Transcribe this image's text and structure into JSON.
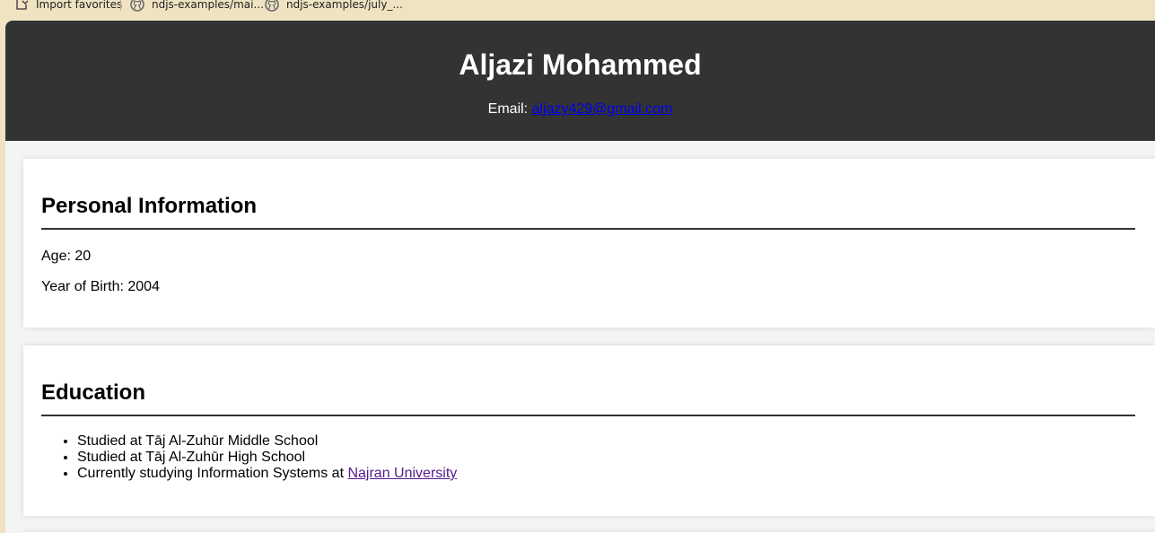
{
  "bookmarks": [
    {
      "label": "Import favorites",
      "icon": "import-icon"
    },
    {
      "label": "ndjs-examples/mai...",
      "icon": "github-icon"
    },
    {
      "label": "ndjs-examples/july_...",
      "icon": "github-icon"
    }
  ],
  "header": {
    "name": "Aljazi Mohammed",
    "email_label": "Email: ",
    "email": "aljazy429@gmail.com"
  },
  "personal": {
    "title": "Personal Information",
    "age": "Age: 20",
    "birth": "Year of Birth: 2004"
  },
  "education": {
    "title": "Education",
    "items": [
      {
        "text": "Studied at Tāj Al-Zuhūr Middle School"
      },
      {
        "text": "Studied at Tāj Al-Zuhūr High School"
      },
      {
        "text": "Currently studying Information Systems at ",
        "link": "Najran University"
      }
    ]
  },
  "colors": {
    "header_bg": "#333333",
    "link": "#0000ee",
    "visited_link": "#551a8b",
    "bookmarks_bg": "#f0e3c2"
  }
}
